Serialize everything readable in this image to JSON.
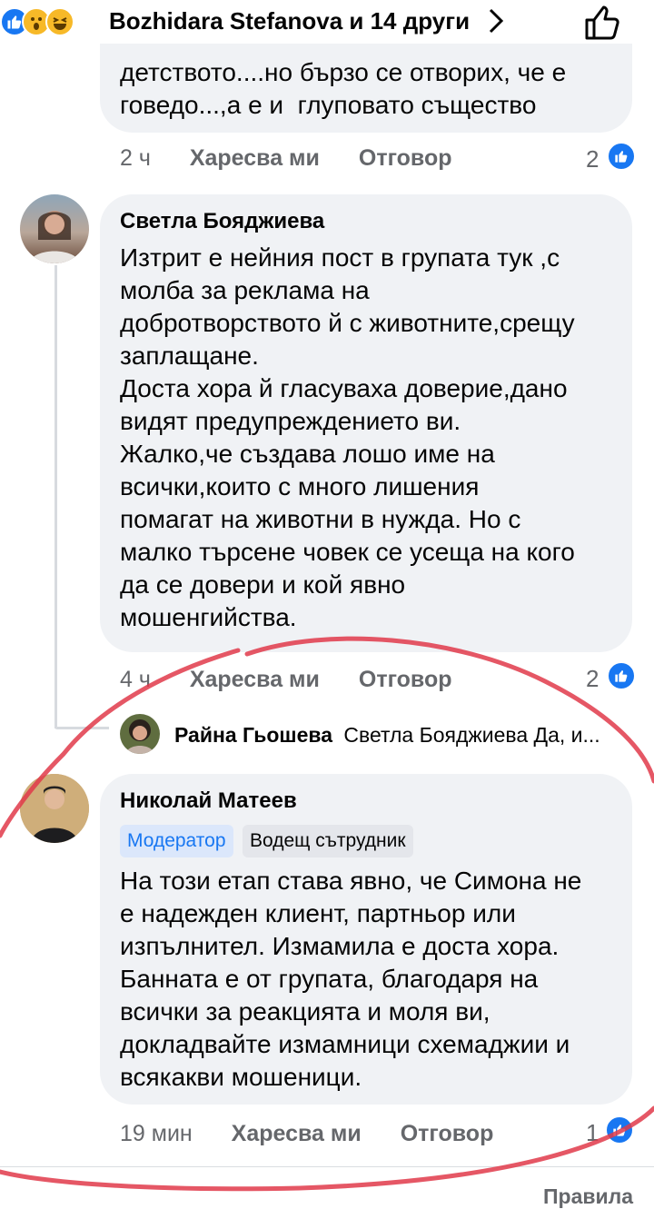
{
  "header": {
    "reactions": [
      "like-icon",
      "wow-icon",
      "haha-icon"
    ],
    "reactors_text": "Bozhidara Stefanova и 14 други"
  },
  "comment1": {
    "text": "детството....но бързо се отворих, че е\nговедо...,а е и  глуповато същество",
    "time": "2 ч",
    "like": "Харесва ми",
    "reply": "Отговор",
    "reaction_count": "2"
  },
  "comment2": {
    "author": "Светла Бояджиева",
    "text": "Изтрит е нейния пост в групата тук ,с\nмолба за реклама на\nдобротворството й с животните,срещу\nзаплащане.\nДоста хора й гласуваха доверие,дано\nвидят предупреждението ви.\nЖалко,че създава лошо име на\nвсички,които с много лишения\nпомагат на животни в нужда. Но с\nмалко търсене човек се усеща на кого\nда се довери и кой явно\nмошенгийства.",
    "time": "4 ч",
    "like": "Харесва ми",
    "reply": "Отговор",
    "reaction_count": "2",
    "reply_preview": {
      "author": "Райна Гьошева",
      "snippet": "Светла Бояджиева Да, и..."
    }
  },
  "comment3": {
    "author": "Николай Матеев",
    "badges": [
      "Модератор",
      "Водещ сътрудник"
    ],
    "text": "На този етап става явно, че Симона не\nе надежден клиент, партньор или\nизпълнител. Измамила е доста хора.\nБанната е от групата, благодаря на\nвсички за реакцията и моля ви,\nдокладвайте измамници схемаджии и\nвсякакви мошеници.",
    "time": "19 мин",
    "like": "Харесва ми",
    "reply": "Отговор",
    "reaction_count": "1"
  },
  "footer": {
    "rules_link": "Правила"
  },
  "colors": {
    "accent": "#1877f2",
    "bubble": "#f0f2f5",
    "meta": "#65676b",
    "scribble": "#e0394a"
  }
}
